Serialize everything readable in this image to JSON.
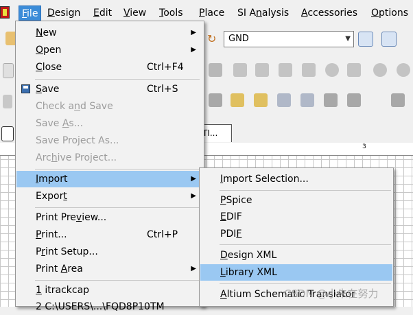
{
  "menubar": {
    "items": [
      {
        "label": "File",
        "key": "F",
        "rest": "ile"
      },
      {
        "label": "Design",
        "key": "D",
        "rest": "esign"
      },
      {
        "label": "Edit",
        "key": "E",
        "rest": "dit"
      },
      {
        "label": "View",
        "key": "V",
        "rest": "iew"
      },
      {
        "label": "Tools",
        "key": "T",
        "rest": "ools"
      },
      {
        "label": "Place",
        "key": "P",
        "rest": "lace"
      },
      {
        "label": "SI Analysis",
        "pre": "SI A",
        "key": "n",
        "rest": "alysis"
      },
      {
        "label": "Accessories",
        "key": "A",
        "rest": "ccessories"
      },
      {
        "label": "Options",
        "key": "O",
        "rest": "ptions"
      }
    ]
  },
  "toolbar": {
    "net_combo_value": "GND",
    "doc_tab_label": "TI..."
  },
  "ruler": {
    "mark": "3"
  },
  "file_menu": {
    "items": [
      {
        "pre": "",
        "key": "N",
        "rest": "ew",
        "shortcut": "",
        "submenu": true,
        "enabled": true
      },
      {
        "pre": "",
        "key": "O",
        "rest": "pen",
        "shortcut": "",
        "submenu": true,
        "enabled": true
      },
      {
        "pre": "",
        "key": "C",
        "rest": "lose",
        "shortcut": "Ctrl+F4",
        "submenu": false,
        "enabled": true
      },
      {
        "pre": "",
        "key": "S",
        "rest": "ave",
        "shortcut": "Ctrl+S",
        "submenu": false,
        "enabled": true
      },
      {
        "pre": "Check a",
        "key": "n",
        "rest": "d Save",
        "shortcut": "",
        "submenu": false,
        "enabled": false
      },
      {
        "pre": "Save ",
        "key": "A",
        "rest": "s...",
        "shortcut": "",
        "submenu": false,
        "enabled": false
      },
      {
        "pre": "Save Project As...",
        "key": "",
        "rest": "",
        "shortcut": "",
        "submenu": false,
        "enabled": false
      },
      {
        "pre": "Arc",
        "key": "h",
        "rest": "ive Project...",
        "shortcut": "",
        "submenu": false,
        "enabled": false
      },
      {
        "pre": "",
        "key": "I",
        "rest": "mport",
        "shortcut": "",
        "submenu": true,
        "enabled": true
      },
      {
        "pre": "Expor",
        "key": "t",
        "rest": "",
        "shortcut": "",
        "submenu": true,
        "enabled": true
      },
      {
        "pre": "Print Pre",
        "key": "v",
        "rest": "iew...",
        "shortcut": "",
        "submenu": false,
        "enabled": true
      },
      {
        "pre": "",
        "key": "P",
        "rest": "rint...",
        "shortcut": "Ctrl+P",
        "submenu": false,
        "enabled": true
      },
      {
        "pre": "P",
        "key": "r",
        "rest": "int Setup...",
        "shortcut": "",
        "submenu": false,
        "enabled": true
      },
      {
        "pre": "Print ",
        "key": "A",
        "rest": "rea",
        "shortcut": "",
        "submenu": true,
        "enabled": true
      },
      {
        "pre": "",
        "key": "1",
        "rest": " itrackcap",
        "shortcut": "",
        "submenu": false,
        "enabled": true
      },
      {
        "pre": "2 C:\\USERS\\...\\FQD8P10TM",
        "key": "",
        "rest": "",
        "shortcut": "",
        "submenu": false,
        "enabled": true
      }
    ]
  },
  "import_menu": {
    "items": [
      {
        "pre": "",
        "key": "I",
        "rest": "mport Selection..."
      },
      {
        "pre": "",
        "key": "P",
        "rest": "Spice"
      },
      {
        "pre": "",
        "key": "E",
        "rest": "DIF"
      },
      {
        "pre": "PDI",
        "key": "F",
        "rest": ""
      },
      {
        "pre": "",
        "key": "D",
        "rest": "esign XML"
      },
      {
        "pre": "",
        "key": "L",
        "rest": "ibrary XML"
      },
      {
        "pre": "",
        "key": "A",
        "rest": "ltium Schematic Translator"
      }
    ]
  },
  "watermark": "CSDN @小朱在努力",
  "colors": {
    "menu_highlight": "#9ac8f2",
    "menubar_active": "#3c8cd8"
  }
}
